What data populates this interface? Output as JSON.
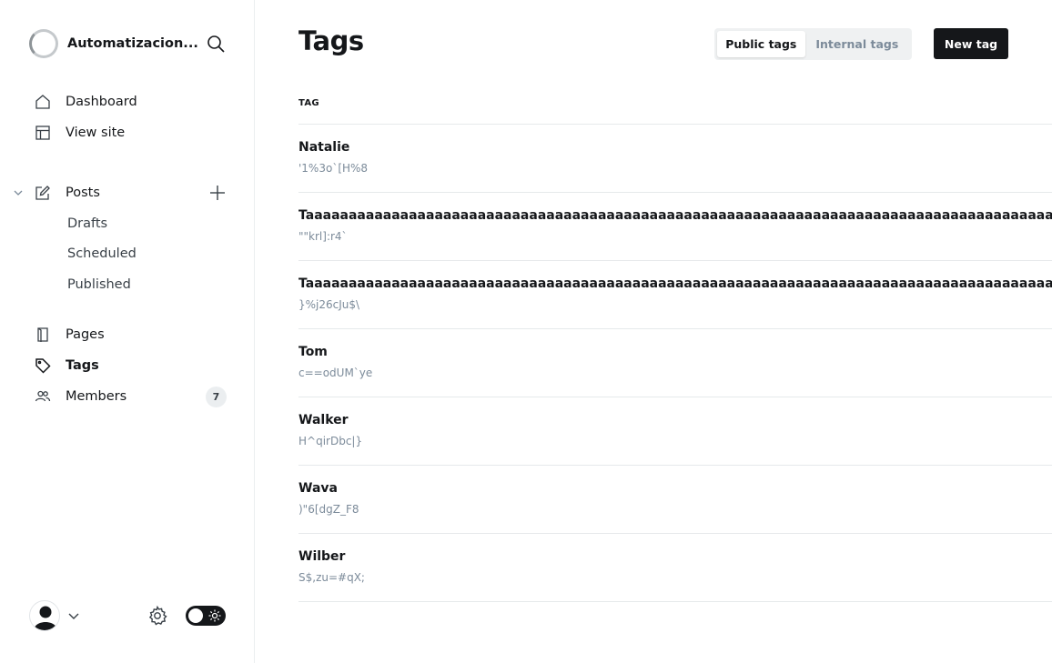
{
  "sidebar": {
    "site_name": "Automatizacion...",
    "nav": {
      "dashboard": "Dashboard",
      "view_site": "View site",
      "posts": "Posts",
      "drafts": "Drafts",
      "scheduled": "Scheduled",
      "published": "Published",
      "pages": "Pages",
      "tags": "Tags",
      "members": "Members",
      "members_count": "7"
    }
  },
  "header": {
    "title": "Tags",
    "tabs": [
      "Public tags",
      "Internal tags"
    ],
    "active_tab": "Public tags",
    "new_button": "New tag"
  },
  "table": {
    "column_header": "TAG",
    "rows": [
      {
        "name": "Natalie",
        "slug": "'1%3o`[H%8"
      },
      {
        "name": "Taaaaaaaaaaaaaaaaaaaaaaaaaaaaaaaaaaaaaaaaaaaaaaaaaaaaaaaaaaaaaaaaaaaaaaaaaaaaaaaaaaaaaaaaaaaaaa",
        "slug": "\"\"krl]:r4`"
      },
      {
        "name": "Taaaaaaaaaaaaaaaaaaaaaaaaaaaaaaaaaaaaaaaaaaaaaaaaaaaaaaaaaaaaaaaaaaaaaaaaaaaaaaaaaaaaaaaaaaaaaa",
        "slug": "}%j26cJu$\\"
      },
      {
        "name": "Tom",
        "slug": "c==odUM`ye"
      },
      {
        "name": "Walker",
        "slug": "H^qirDbc|}"
      },
      {
        "name": "Wava",
        "slug": ")\"6[dgZ_F8"
      },
      {
        "name": "Wilber",
        "slug": "S$,zu=#qX;"
      }
    ]
  },
  "icons": {
    "search": "search-icon",
    "dashboard": "home-icon",
    "view_site": "layout-icon",
    "posts": "pencil-square-icon",
    "pages": "page-icon",
    "tags": "tag-icon",
    "members": "users-icon",
    "settings": "gear-icon",
    "theme": "sun-icon"
  },
  "colors": {
    "accent_dark": "#15171a",
    "muted": "#7c8b9a",
    "border": "#e6e9eb"
  }
}
